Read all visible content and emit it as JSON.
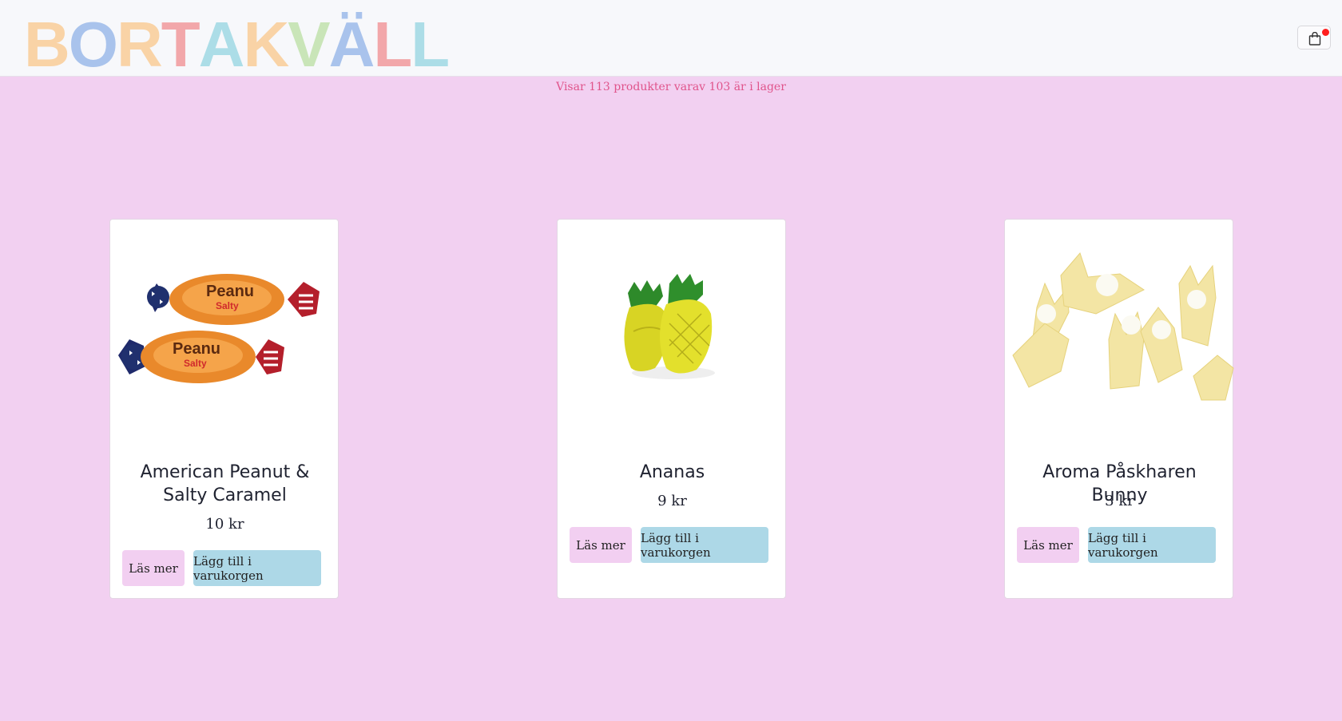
{
  "header": {
    "logo_letters": [
      "B",
      "O",
      "R",
      "T",
      "A",
      "K",
      "V",
      "Ä",
      "L",
      "L"
    ],
    "logo_colors": [
      "#f9d3a6",
      "#a9c3ec",
      "#f9d3a6",
      "#f2a7aa",
      "#acdde7",
      "#f9d3a6",
      "#c9e5b8",
      "#a9c3ec",
      "#f2a7aa",
      "#acdde7"
    ],
    "cart_icon": "shopping-bag-icon"
  },
  "stock_info": "Visar 113 produkter varav 103 är i lager",
  "products": [
    {
      "name": "American Peanut & Salty Caramel",
      "price": "10 kr",
      "more_label": "Läs mer",
      "add_label": "Lägg till i varukorgen",
      "image": "peanut-caramel-candy-image"
    },
    {
      "name": "Ananas",
      "price": "9 kr",
      "more_label": "Läs mer",
      "add_label": "Lägg till i varukorgen",
      "image": "pineapple-candy-image"
    },
    {
      "name": "Aroma Påskharen Bunny",
      "price": "3 kr",
      "more_label": "Läs mer",
      "add_label": "Lägg till i varukorgen",
      "image": "bunny-candy-image"
    }
  ]
}
